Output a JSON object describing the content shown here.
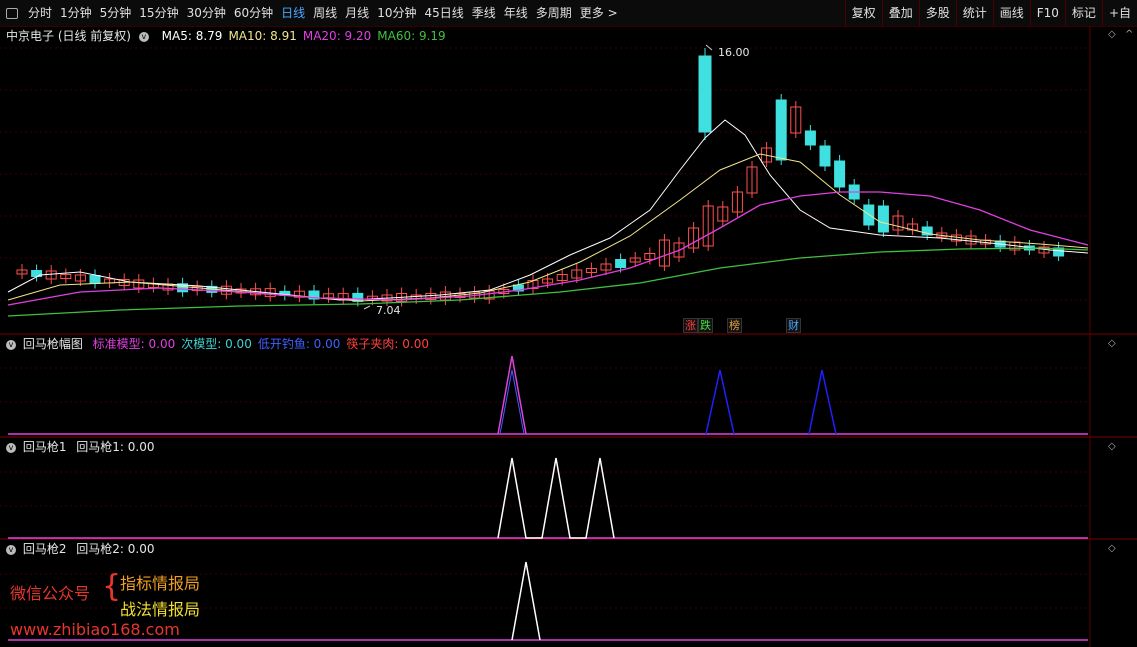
{
  "toolbar": {
    "periods": [
      "分时",
      "1分钟",
      "5分钟",
      "15分钟",
      "30分钟",
      "60分钟",
      "日线",
      "周线",
      "月线",
      "10分钟",
      "45日线",
      "季线",
      "年线",
      "多周期",
      "更多"
    ],
    "active_period": "日线",
    "right": [
      "复权",
      "叠加",
      "多股",
      "统计",
      "画线",
      "F10",
      "标记",
      "+自"
    ]
  },
  "main": {
    "stock": "中京电子 (日线 前复权)",
    "ma": [
      {
        "label": "MA5: 8.79",
        "color": "#ffffff"
      },
      {
        "label": "MA10: 8.91",
        "color": "#f0e68c"
      },
      {
        "label": "MA20: 9.20",
        "color": "#e040e0"
      },
      {
        "label": "MA60: 9.19",
        "color": "#40c040"
      }
    ],
    "high_label": "16.00",
    "low_label": "7.04",
    "event_tags": [
      {
        "text": "涨",
        "color": "#ff4040"
      },
      {
        "text": "跌",
        "color": "#40e040"
      },
      {
        "text": "榜",
        "color": "#e0a040"
      },
      {
        "text": "财",
        "color": "#4aa8ff"
      }
    ]
  },
  "panel1": {
    "title": "回马枪幅图",
    "fields": [
      {
        "label": "标准模型: 0.00",
        "color": "#e040e0"
      },
      {
        "label": "次模型: 0.00",
        "color": "#40d0d0"
      },
      {
        "label": "低开钓鱼: 0.00",
        "color": "#4060ff"
      },
      {
        "label": "筷子夹肉: 0.00",
        "color": "#ff4040"
      }
    ]
  },
  "panel2": {
    "title": "回马枪1",
    "value": "回马枪1: 0.00"
  },
  "panel3": {
    "title": "回马枪2",
    "value": "回马枪2: 0.00"
  },
  "watermark": {
    "left": "微信公众号",
    "brace": "{",
    "line1": "指标情报局",
    "line2": "战法情报局",
    "url": "www.zhibiao168.com"
  }
}
